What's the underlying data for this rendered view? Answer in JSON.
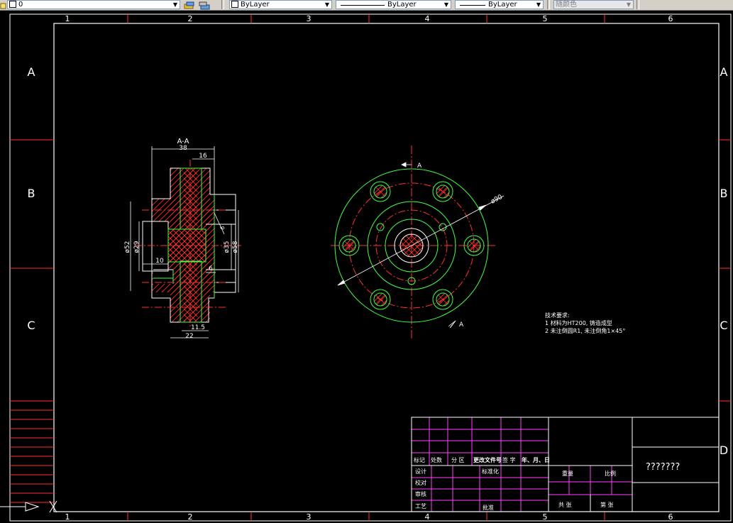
{
  "toolbar": {
    "layer_value": "0",
    "color_value": "ByLayer",
    "linetype_value": "ByLayer",
    "lineweight_value": "ByLayer",
    "plotstyle_value": "随颜色"
  },
  "frame": {
    "column_labels": [
      "1",
      "2",
      "3",
      "4",
      "5",
      "6"
    ],
    "row_labels": [
      "A",
      "B",
      "C",
      "D"
    ]
  },
  "section_view": {
    "title": "A-A",
    "dim_38": "38",
    "dim_16": "16",
    "dim_52": "ø52",
    "dim_29": "ø29",
    "dim_10": "10",
    "dim_35": "ø35",
    "dim_58": "ø58",
    "dim_r6": "6",
    "dim_6": "6",
    "dim_11_5": "11.5",
    "dim_22": "22"
  },
  "front_view": {
    "dim_90": "ø90",
    "cut_label_top": "A",
    "cut_label_bottom": "A"
  },
  "notes": {
    "title": "技术要求:",
    "line1": "1  材料为HT200, 铸造成型",
    "line2": "2  未注倒圆R1, 未注倒角1×45°"
  },
  "title_block": {
    "hdr_mark": "标记",
    "hdr_count": "处数",
    "hdr_zone": "分 区",
    "hdr_docno": "更改文件号",
    "hdr_sign": "签 字",
    "hdr_date": "年、月、日",
    "design": "设计",
    "standard": "标准化",
    "check": "校对",
    "review": "审核",
    "process": "工艺",
    "approve": "批准",
    "weight": "重量",
    "scale": "比例",
    "total_sheets": "共    张",
    "sheet_no": "第    张",
    "drawing_name": "???????"
  }
}
